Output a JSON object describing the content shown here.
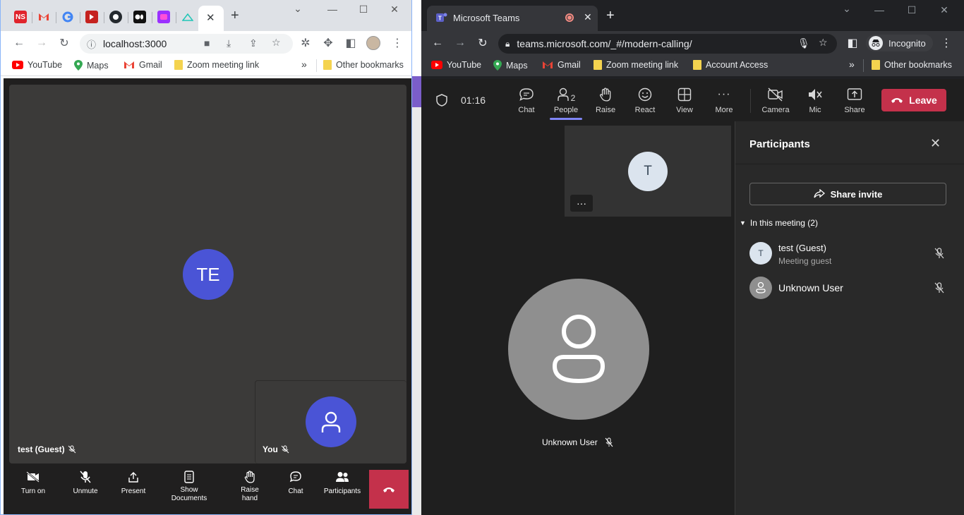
{
  "left_browser": {
    "tabs": [
      "NS",
      "M",
      "G",
      "A",
      "GH",
      "M2",
      "T",
      "N"
    ],
    "url": "localhost:3000",
    "bookmarks": [
      "YouTube",
      "Maps",
      "Gmail",
      "Zoom meeting link"
    ],
    "other_bookmarks": "Other bookmarks",
    "overflow": "»"
  },
  "left_app": {
    "remote_initials": "TE",
    "remote_label": "test (Guest)",
    "self_label": "You",
    "controls": {
      "turn_on": "Turn on",
      "unmute": "Unmute",
      "present": "Present",
      "show_documents": "Show Documents",
      "raise_hand": "Raise hand",
      "chat": "Chat",
      "participants": "Participants"
    },
    "colors": {
      "avatar": "#4a54d6",
      "hangup": "#c4314b"
    }
  },
  "right_browser": {
    "tab_title": "Microsoft Teams",
    "url": "teams.microsoft.com/_#/modern-calling/",
    "incognito": "Incognito",
    "bookmarks": [
      "YouTube",
      "Maps",
      "Gmail",
      "Zoom meeting link",
      "Account Access"
    ],
    "other_bookmarks": "Other bookmarks",
    "overflow": "»"
  },
  "teams": {
    "timer": "01:16",
    "people_count": "2",
    "buttons": {
      "chat": "Chat",
      "people": "People",
      "raise": "Raise",
      "react": "React",
      "view": "View",
      "more": "More",
      "camera": "Camera",
      "mic": "Mic",
      "share": "Share",
      "leave": "Leave"
    },
    "small_tile_initial": "T",
    "more_dots": "···",
    "main_user": "Unknown User",
    "panel": {
      "title": "Participants",
      "share_invite": "Share invite",
      "section": "In this meeting (2)",
      "participants": [
        {
          "initial": "T",
          "name": "test (Guest)",
          "sub": "Meeting guest"
        },
        {
          "initial": "",
          "name": "Unknown User",
          "sub": ""
        }
      ]
    },
    "colors": {
      "accent": "#7f85f5",
      "leave": "#c4314b"
    }
  }
}
